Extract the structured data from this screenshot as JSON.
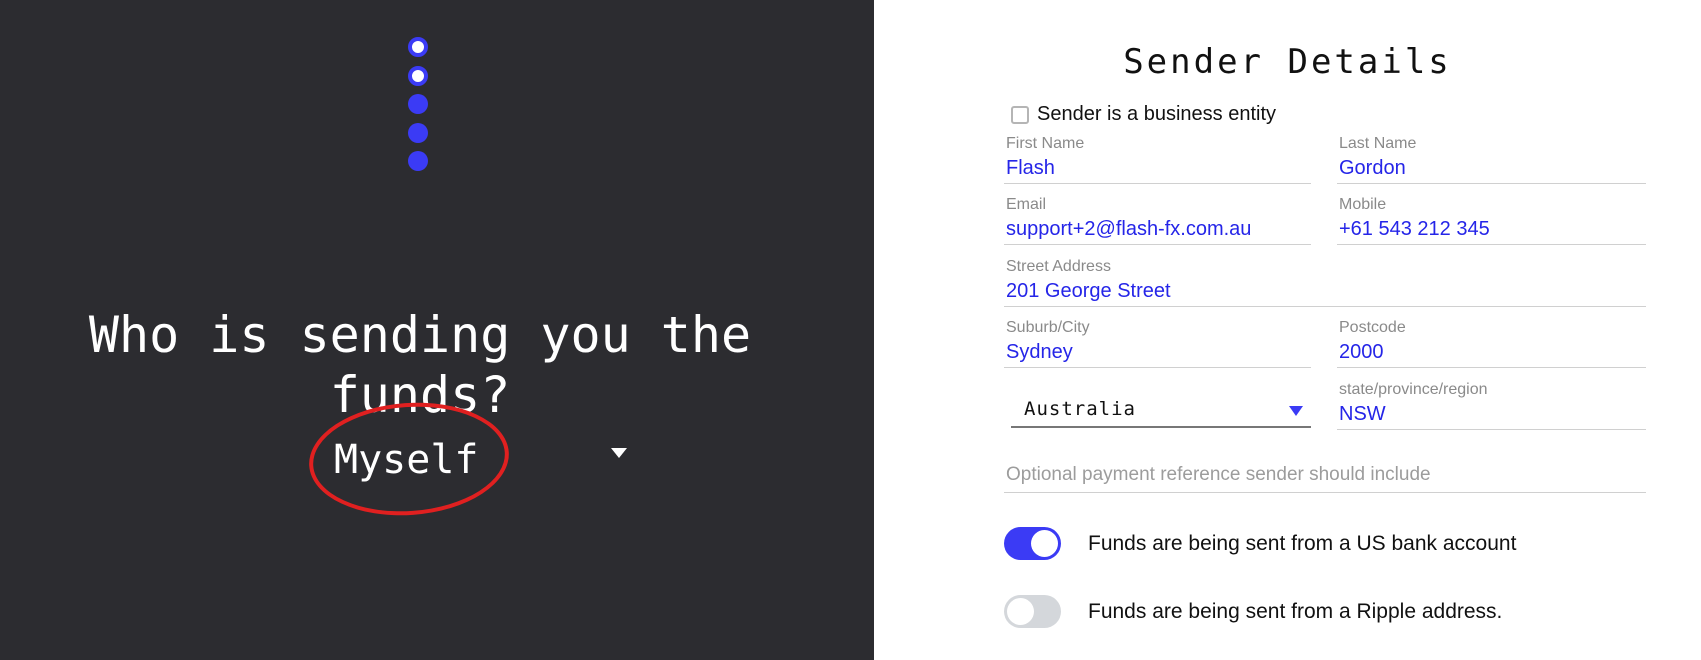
{
  "left": {
    "progress": {
      "completed_steps": 2,
      "total_steps": 5
    },
    "question": "Who is sending you the funds?",
    "sender_select": {
      "value": "Myself"
    }
  },
  "form": {
    "title": "Sender Details",
    "business_checkbox": {
      "label": "Sender is a business entity",
      "checked": false
    },
    "fields": {
      "first_name": {
        "label": "First Name",
        "value": "Flash"
      },
      "last_name": {
        "label": "Last Name",
        "value": "Gordon"
      },
      "email": {
        "label": "Email",
        "value": "support+2@flash-fx.com.au"
      },
      "mobile": {
        "label": "Mobile",
        "value": "+61 543 212 345"
      },
      "street": {
        "label": "Street Address",
        "value": "201 George Street"
      },
      "suburb": {
        "label": "Suburb/City",
        "value": "Sydney"
      },
      "postcode": {
        "label": "Postcode",
        "value": "2000"
      },
      "region": {
        "label": "state/province/region",
        "value": "NSW"
      }
    },
    "country": {
      "value": "Australia"
    },
    "reference": {
      "placeholder": "Optional payment reference sender should include"
    },
    "toggles": {
      "us_bank": {
        "label": "Funds are being sent from a US bank account",
        "on": true
      },
      "ripple": {
        "label": "Funds are being sent from a Ripple address.",
        "on": false
      }
    }
  },
  "colors": {
    "accent": "#3b3bf5",
    "value_text": "#2525e8",
    "annotation": "#e02020",
    "left_background": "#2c2c30"
  }
}
